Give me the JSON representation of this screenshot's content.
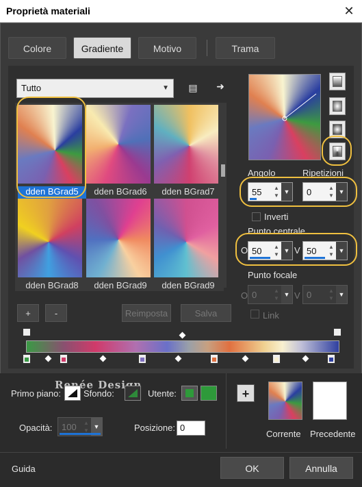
{
  "window": {
    "title": "Proprietà materiali",
    "close_glyph": "✕"
  },
  "tabs": [
    {
      "label": "Colore"
    },
    {
      "label": "Gradiente"
    },
    {
      "label": "Motivo"
    },
    {
      "label": "Trama"
    }
  ],
  "category": {
    "selected": "Tutto"
  },
  "thumbnails": [
    {
      "label": "dden BGrad5",
      "selected": true
    },
    {
      "label": "dden BGrad6",
      "selected": false
    },
    {
      "label": "dden BGrad7",
      "selected": false
    },
    {
      "label": "dden BGrad8",
      "selected": false
    },
    {
      "label": "dden BGrad9",
      "selected": false
    },
    {
      "label": "dden BGrad9",
      "selected": false
    }
  ],
  "list_buttons": {
    "add": "+",
    "remove": "-",
    "reset": "Reimposta",
    "save": "Salva"
  },
  "angle": {
    "label": "Angolo",
    "value": "55"
  },
  "repeats": {
    "label": "Ripetizioni",
    "value": "0"
  },
  "invert": {
    "label": "Inverti"
  },
  "center": {
    "label": "Punto centrale",
    "o_label": "O",
    "o_value": "50",
    "v_label": "V",
    "v_value": "50"
  },
  "focal": {
    "label": "Punto focale",
    "o_label": "O",
    "o_value": "0",
    "v_label": "V",
    "v_value": "0"
  },
  "link": {
    "label": "Link"
  },
  "bottom": {
    "foreground_label": "Primo piano:",
    "background_label": "Sfondo:",
    "user_label": "Utente:",
    "opacity_label": "Opacità:",
    "opacity_value": "100",
    "position_label": "Posizione:",
    "position_value": "0",
    "current_label": "Corrente",
    "previous_label": "Precedente",
    "plus": "+",
    "watermark": "Renée Design"
  },
  "footer": {
    "help": "Guida",
    "ok": "OK",
    "cancel": "Annulla"
  },
  "colors": {
    "accent": "#1e73d6",
    "highlight": "#f0c040",
    "user_swatch": "#2e9a3a"
  }
}
